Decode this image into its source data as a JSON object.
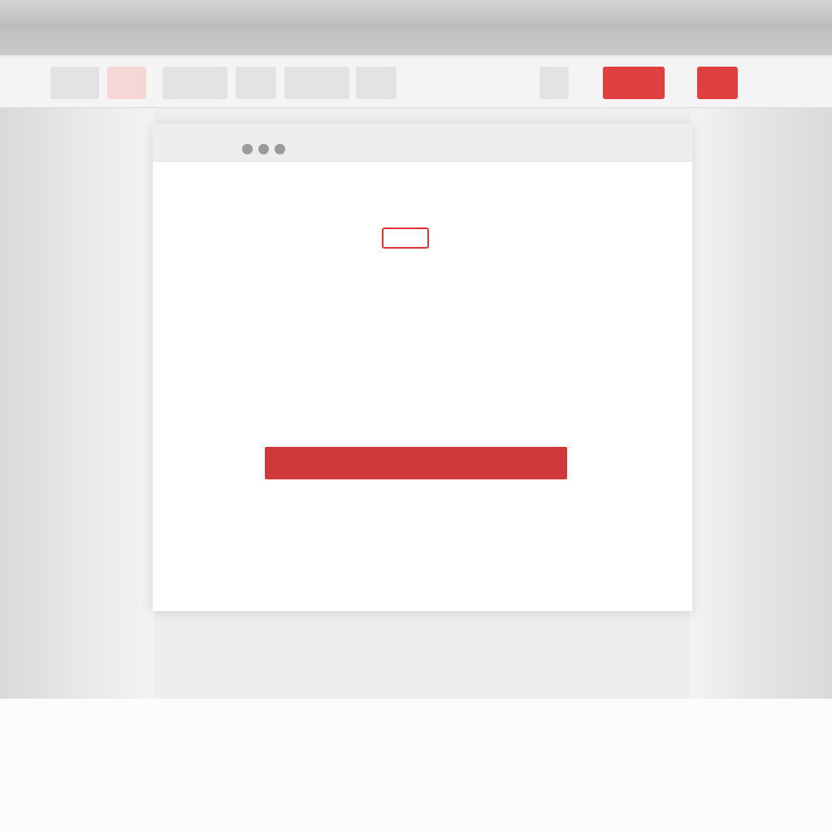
{
  "colors": {
    "accent": "#d0393a",
    "tab_active": "#e0403f",
    "dialog_bg": "#ffffff",
    "page_bg": "#eeeeee"
  },
  "tabs": [
    {
      "label": ""
    },
    {
      "label": ""
    },
    {
      "label": ""
    },
    {
      "label": ""
    },
    {
      "label": ""
    },
    {
      "label": ""
    },
    {
      "label": ""
    },
    {
      "label": ""
    },
    {
      "label": ""
    }
  ],
  "dialog": {
    "title": "",
    "brand": "",
    "heading": "",
    "body_line_1": "",
    "body_line_2": "",
    "note_line_1": "",
    "note_line_2": "",
    "button_label": "",
    "footer_line": "",
    "footer_link": ""
  },
  "icons": {
    "window_controls": [
      "close-icon",
      "minimize-icon",
      "maximize-icon"
    ]
  }
}
